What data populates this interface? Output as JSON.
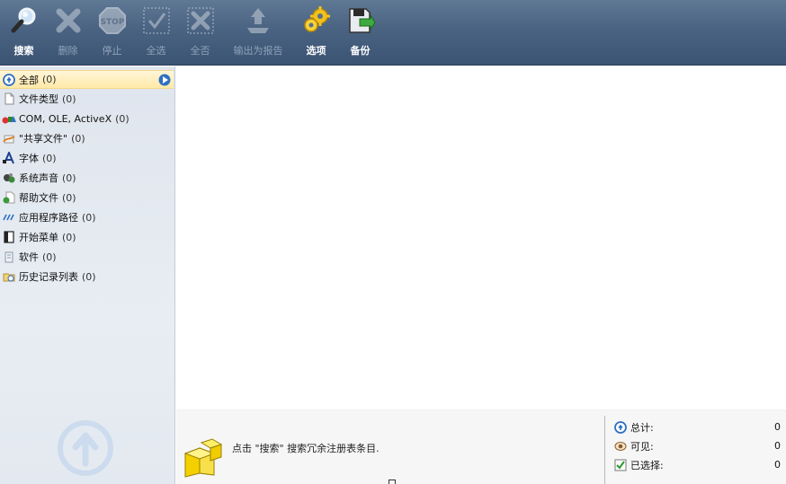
{
  "toolbar": {
    "buttons": [
      {
        "label": "搜索",
        "icon": "magnifier-icon",
        "enabled": true
      },
      {
        "label": "删除",
        "icon": "delete-x-icon",
        "enabled": false
      },
      {
        "label": "停止",
        "icon": "stop-sign-icon",
        "enabled": false
      },
      {
        "label": "全选",
        "icon": "check-all-icon",
        "enabled": false
      },
      {
        "label": "全否",
        "icon": "uncheck-all-icon",
        "enabled": false
      },
      {
        "label": "输出为报告",
        "icon": "export-report-icon",
        "enabled": false
      },
      {
        "label": "选项",
        "icon": "gears-icon",
        "enabled": true
      },
      {
        "label": "备份",
        "icon": "backup-icon",
        "enabled": true
      }
    ]
  },
  "sidebar": {
    "items": [
      {
        "name": "全部",
        "count": "(0)",
        "icon": "all-info-icon"
      },
      {
        "name": "文件类型",
        "count": "(0)",
        "icon": "file-type-icon"
      },
      {
        "name": "COM, OLE, ActiveX",
        "count": "(0)",
        "icon": "com-shapes-icon"
      },
      {
        "name": "\"共享文件\"",
        "count": "(0)",
        "icon": "shared-file-icon"
      },
      {
        "name": "字体",
        "count": "(0)",
        "icon": "font-icon"
      },
      {
        "name": "系统声音",
        "count": "(0)",
        "icon": "system-sound-icon"
      },
      {
        "name": "帮助文件",
        "count": "(0)",
        "icon": "help-file-icon"
      },
      {
        "name": "应用程序路径",
        "count": "(0)",
        "icon": "app-path-icon"
      },
      {
        "name": "开始菜单",
        "count": "(0)",
        "icon": "start-menu-icon"
      },
      {
        "name": "软件",
        "count": "(0)",
        "icon": "software-icon"
      },
      {
        "name": "历史记录列表",
        "count": "(0)",
        "icon": "history-list-icon"
      }
    ],
    "selected_index": 0
  },
  "status": {
    "hint": "点击 \"搜索\" 搜索冗余注册表条目.",
    "stats": [
      {
        "label": "总计:",
        "value": "0",
        "icon": "total-info-icon"
      },
      {
        "label": "可见:",
        "value": "0",
        "icon": "visible-eye-icon"
      },
      {
        "label": "已选择:",
        "value": "0",
        "icon": "selected-check-icon"
      }
    ]
  },
  "colors": {
    "toolbar_top": "#5f7894",
    "toolbar_bottom": "#3c5473",
    "sidebar_bg": "#e3e9f0",
    "selection_bg": "#ffe9a8",
    "accent_blue": "#2f6fc2"
  }
}
